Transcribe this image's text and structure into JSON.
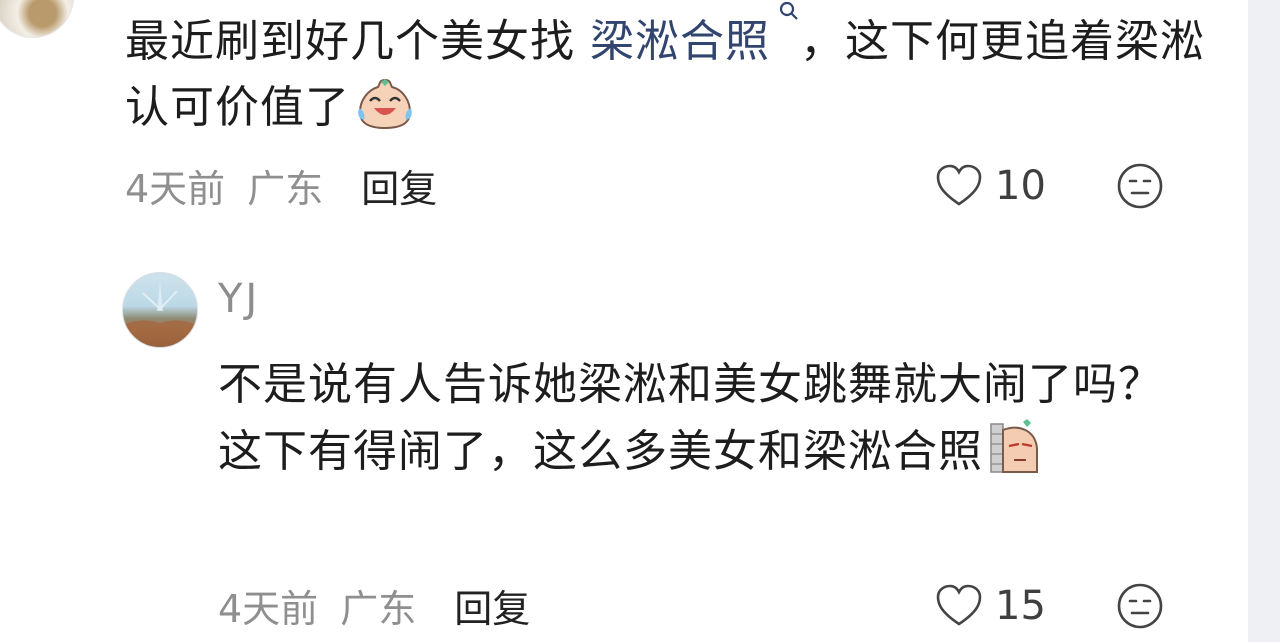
{
  "comments": [
    {
      "text_part1": "最近刷到好几个美女找 ",
      "link": "梁淞合照",
      "text_part2": "，这下何更追着梁淞认可价值了",
      "time": "4天前",
      "location": "广东",
      "reply_label": "回复",
      "likes": "10",
      "emoji": "crying-laughing-emoji"
    },
    {
      "username": "YJ",
      "text": "不是说有人告诉她梁淞和美女跳舞就大闹了吗？这下有得闹了，这么多美女和梁淞合照",
      "time": "4天前",
      "location": "广东",
      "reply_label": "回复",
      "likes": "15",
      "emoji": "peeking-emoji"
    }
  ],
  "colors": {
    "link": "#31456f",
    "meta": "#8f8f8f",
    "text": "#1d1d1d"
  }
}
